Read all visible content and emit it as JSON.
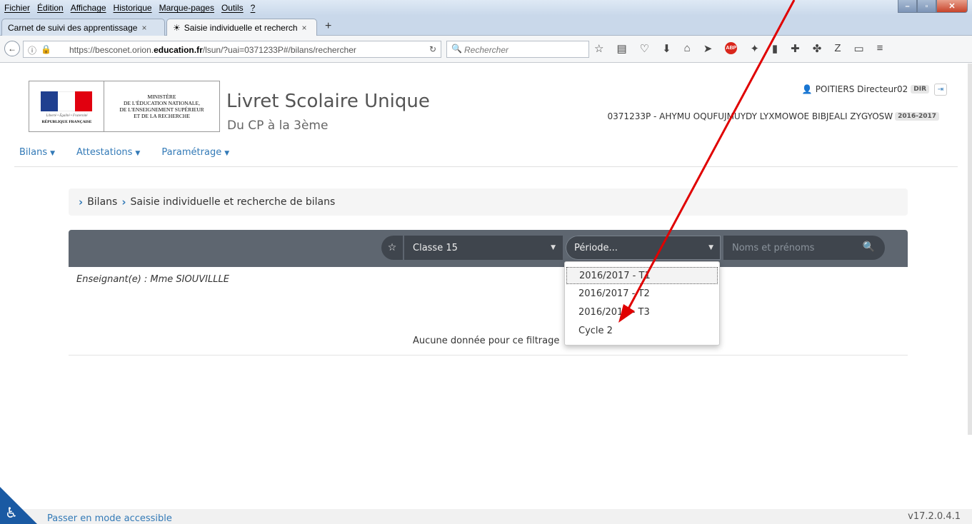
{
  "browser": {
    "menu": [
      "Fichier",
      "Édition",
      "Affichage",
      "Historique",
      "Marque-pages",
      "Outils",
      "?"
    ],
    "tabs": [
      {
        "label": "Carnet de suivi des apprentissage",
        "close": "×"
      },
      {
        "label": "Saisie individuelle et recherch",
        "close": "×"
      }
    ],
    "new_tab": "+",
    "url_prefix": "https://besconet.orion.",
    "url_domain": "education.fr",
    "url_suffix": "/lsun/?uai=0371233P#/bilans/rechercher",
    "search_placeholder": "Rechercher"
  },
  "header": {
    "ministry": [
      "MINISTÈRE",
      "DE L'ÉDUCATION NATIONALE,",
      "DE L'ENSEIGNEMENT SUPÉRIEUR",
      "ET DE LA RECHERCHE"
    ],
    "motto": "Liberté • Égalité • Fraternité",
    "republic": "RÉPUBLIQUE FRANÇAISE",
    "title": "Livret Scolaire Unique",
    "subtitle": "Du CP à la 3ème",
    "user": "POITIERS Directeur02",
    "role_badge": "DIR",
    "school": "0371233P - AHYMU OQUFUJMUYDY LYXMOWOE BIBJEALI ZYGYOSW",
    "year_badge": "2016-2017"
  },
  "nav": [
    {
      "label": "Bilans"
    },
    {
      "label": "Attestations"
    },
    {
      "label": "Paramétrage"
    }
  ],
  "breadcrumb": [
    "Bilans",
    "Saisie individuelle et recherche de bilans"
  ],
  "filters": {
    "classe": "Classe 15",
    "periode": "Période...",
    "names_placeholder": "Noms et prénoms"
  },
  "teacher": "Enseignant(e) : Mme SIOUVILLLE",
  "no_data": "Aucune donnée pour ce filtrage",
  "dropdown": {
    "options": [
      "2016/2017 - T1",
      "2016/2017 - T2",
      "2016/2017 - T3",
      "Cycle 2"
    ],
    "highlighted": 0
  },
  "footer": {
    "accessible_link": "Passer en mode accessible",
    "version": "v17.2.0.4.1"
  },
  "colors": {
    "link": "#337ab7",
    "filter_bar": "#5e6670",
    "annotation": "#e00000",
    "flag_blue": "#1f3f8f",
    "flag_red": "#e1000f"
  }
}
